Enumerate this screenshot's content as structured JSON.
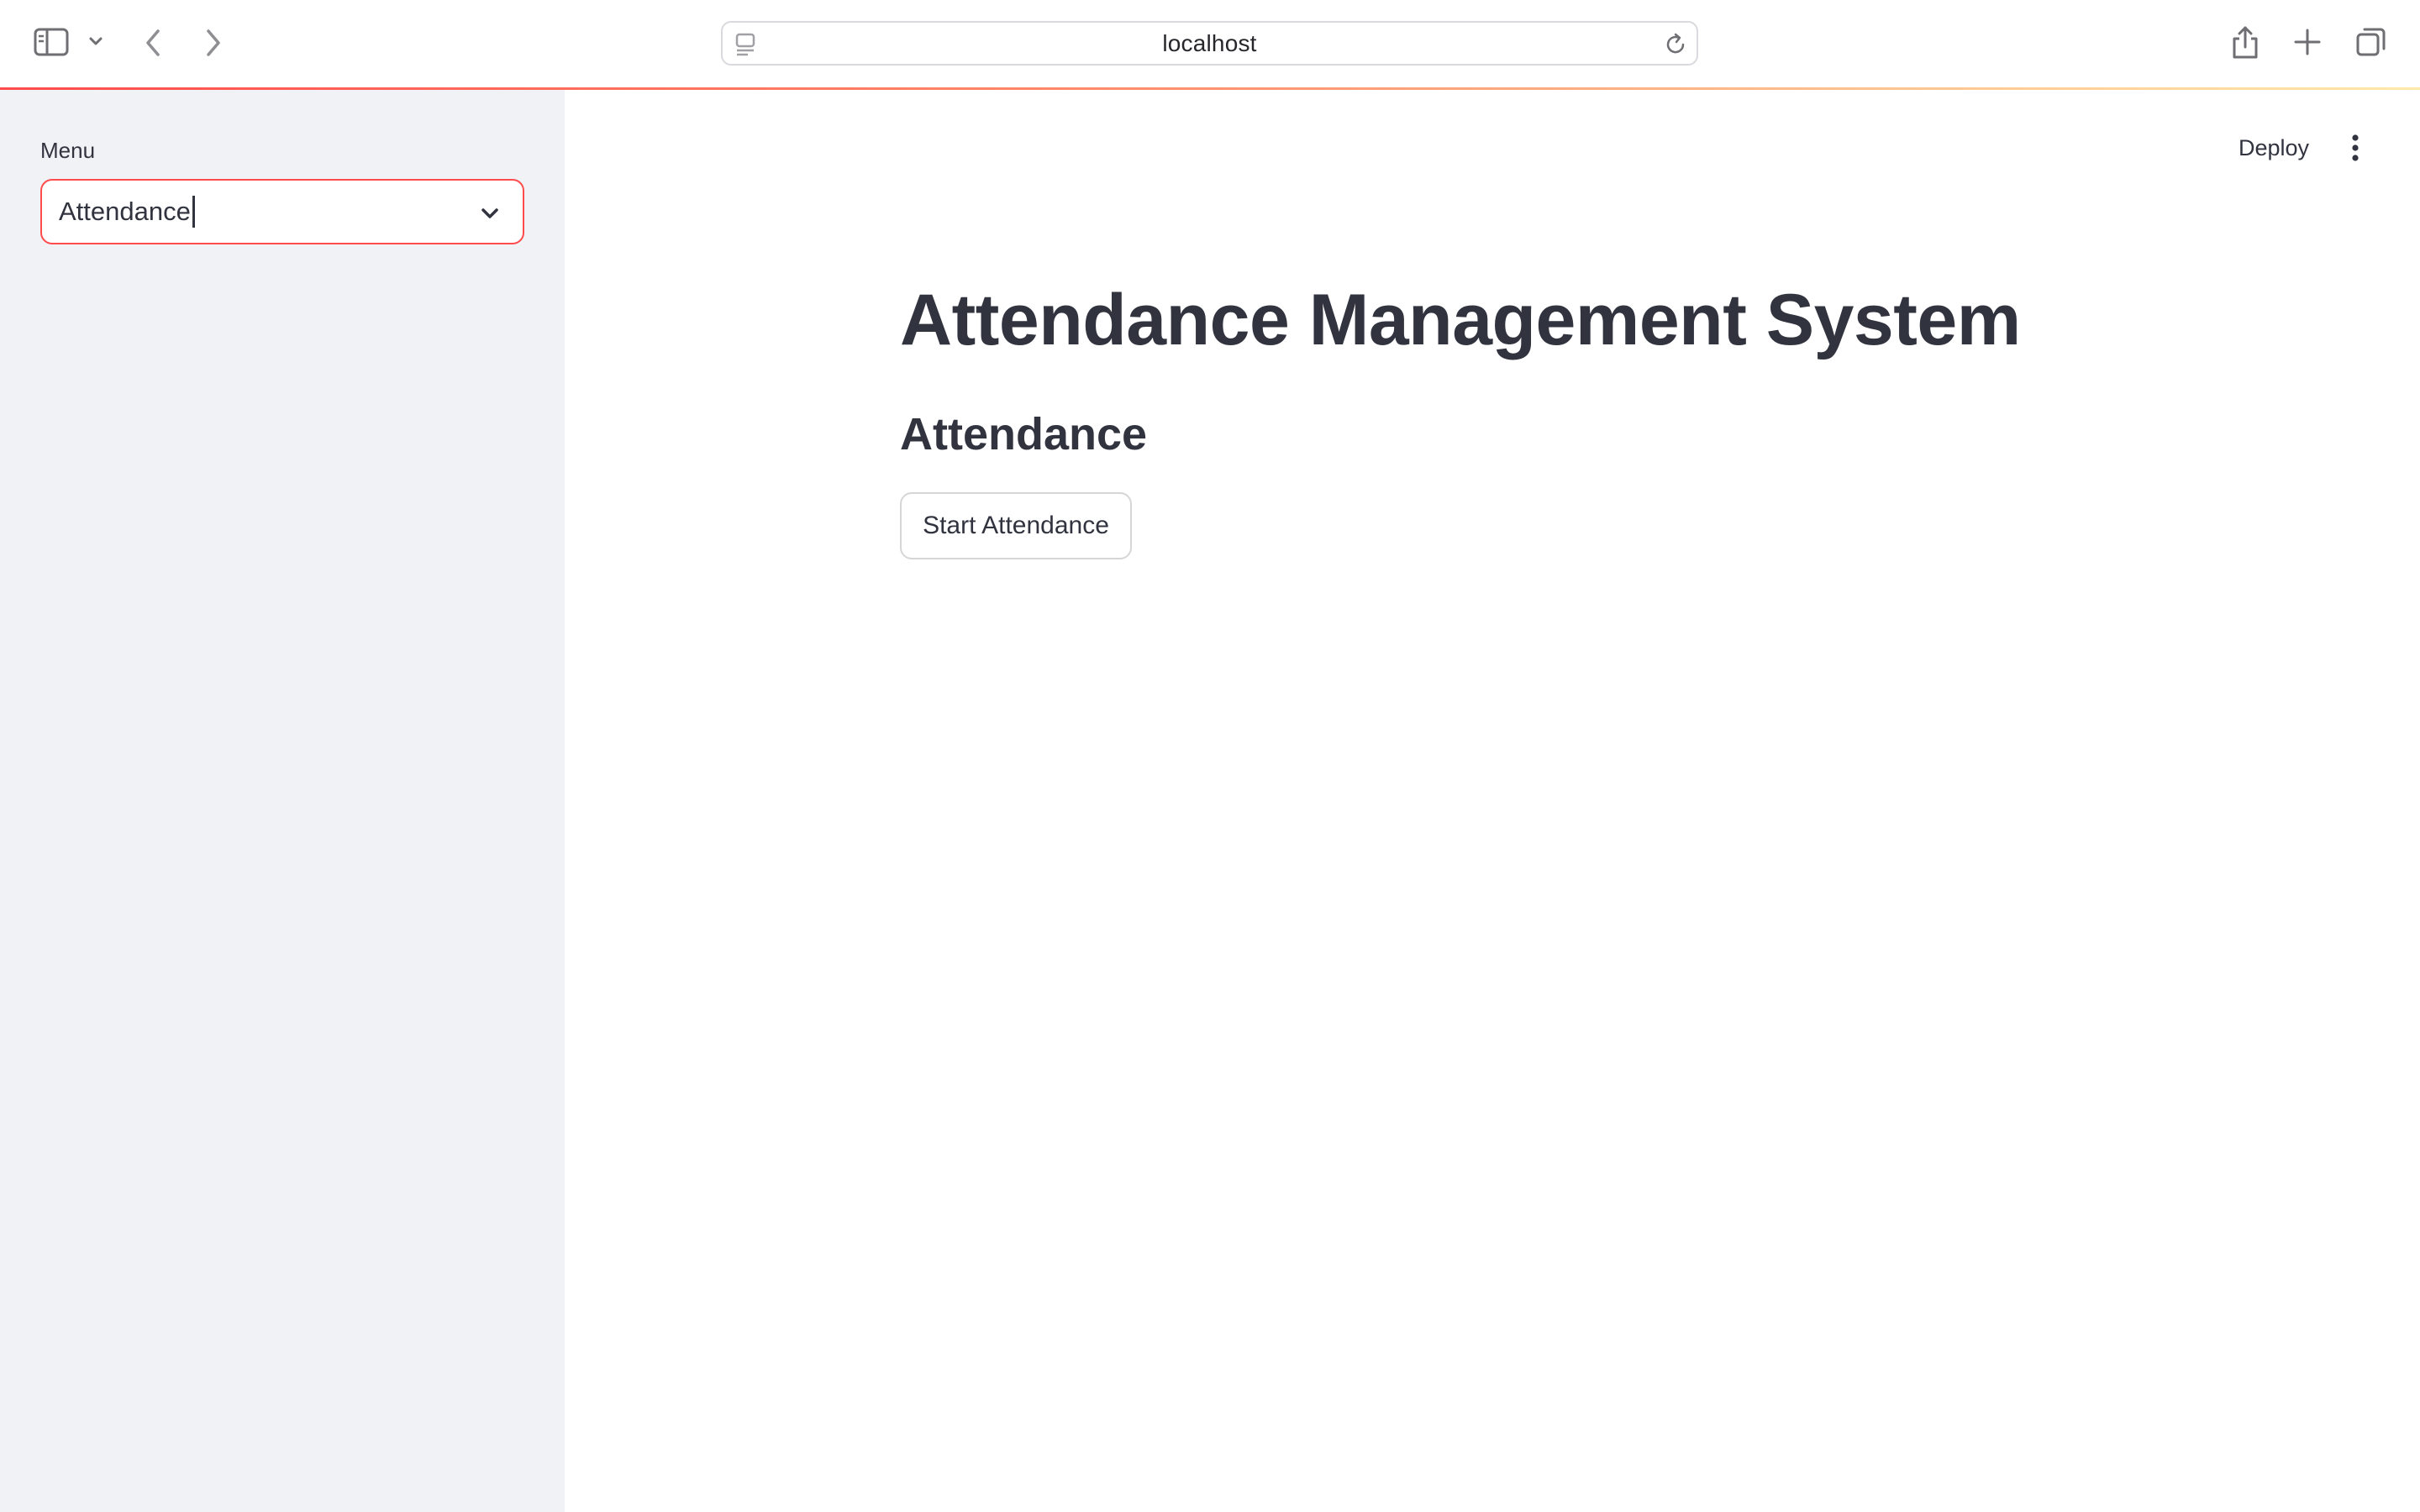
{
  "browser": {
    "url": "localhost",
    "icons": [
      "sidebar-toggle-icon",
      "chevron-down-icon",
      "back-arrow-icon",
      "forward-arrow-icon",
      "site-info-icon",
      "reload-icon",
      "share-icon",
      "new-tab-icon",
      "tab-overview-icon"
    ]
  },
  "sidebar": {
    "menu_label": "Menu",
    "select_value": "Attendance"
  },
  "header": {
    "deploy_label": "Deploy",
    "menu_icon": "kebab-menu-icon"
  },
  "main": {
    "title": "Attendance Management System",
    "section_title": "Attendance",
    "start_button_label": "Start Attendance"
  },
  "colors": {
    "accent": "#ff4b4b",
    "sidebar_bg": "#f0f2f6",
    "text": "#31333f"
  }
}
